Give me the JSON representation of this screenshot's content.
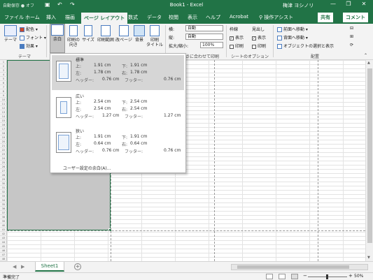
{
  "titlebar": {
    "autosave": "自動保存 ● オフ",
    "title": "Book1 - Excel",
    "user": "梅津 ヨシノリ",
    "controls": [
      "—",
      "❐",
      "✕"
    ]
  },
  "tabs": [
    {
      "label": "ファイル"
    },
    {
      "label": "ホーム"
    },
    {
      "label": "挿入"
    },
    {
      "label": "描画"
    },
    {
      "label": "ページ レイアウト",
      "active": true
    },
    {
      "label": "数式"
    },
    {
      "label": "データ"
    },
    {
      "label": "校閲"
    },
    {
      "label": "表示"
    },
    {
      "label": "ヘルプ"
    },
    {
      "label": "Acrobat"
    }
  ],
  "search": "操作アシスト",
  "share": "共有",
  "comment": "コメント",
  "ribbon": {
    "theme": "テーマ",
    "colors": "配色 ▾",
    "fonts": "フォント ▾",
    "effects": "効果 ▾",
    "theme_group": "テーマ",
    "margins": "余白",
    "orientation": "印刷の\n向き",
    "size": "サイズ",
    "print_area": "印刷範囲",
    "breaks": "改ページ",
    "background": "背景",
    "print_titles": "印刷\nタイトル",
    "width_label": "横:",
    "width_value": "自動",
    "height_label": "縦:",
    "height_value": "自動",
    "scale_label": "拡大/縮小:",
    "scale_value": "100%",
    "fit_group": "大きさに合わせて印刷",
    "gridlines": "枠線",
    "headings": "見出し",
    "view": "表示",
    "print": "印刷",
    "sheet_options_group": "シートのオプション",
    "bring_forward": "前面へ移動 ▾",
    "send_backward": "背面へ移動 ▾",
    "selection_pane": "オブジェクトの選択と表示",
    "arrange_group": "配置"
  },
  "margins_menu": {
    "options": [
      {
        "name": "標準",
        "top_label": "上:",
        "top": "1.91 cm",
        "bottom_label": "下:",
        "bottom": "1.91 cm",
        "left_label": "左:",
        "left": "1.78 cm",
        "right_label": "右:",
        "right": "1.78 cm",
        "header_label": "ヘッダー:",
        "header": "0.76 cm",
        "footer_label": "フッター:",
        "footer": "0.76 cm",
        "selected": true
      },
      {
        "name": "広い",
        "top_label": "上:",
        "top": "2.54 cm",
        "bottom_label": "下:",
        "bottom": "2.54 cm",
        "left_label": "左:",
        "left": "2.54 cm",
        "right_label": "右:",
        "right": "2.54 cm",
        "header_label": "ヘッダー:",
        "header": "1.27 cm",
        "footer_label": "フッター:",
        "footer": "1.27 cm"
      },
      {
        "name": "狭い",
        "top_label": "上:",
        "top": "1.91 cm",
        "bottom_label": "下:",
        "bottom": "1.91 cm",
        "left_label": "左:",
        "left": "0.64 cm",
        "right_label": "右:",
        "right": "0.64 cm",
        "header_label": "ヘッダー:",
        "header": "0.76 cm",
        "footer_label": "フッター:",
        "footer": "0.76 cm"
      }
    ],
    "custom": "ユーザー設定の余白(A)..."
  },
  "sheet": {
    "tab": "Sheet1",
    "add": "+"
  },
  "status": {
    "ready": "準備完了",
    "zoom": "50%",
    "minus": "−",
    "plus": "+"
  }
}
